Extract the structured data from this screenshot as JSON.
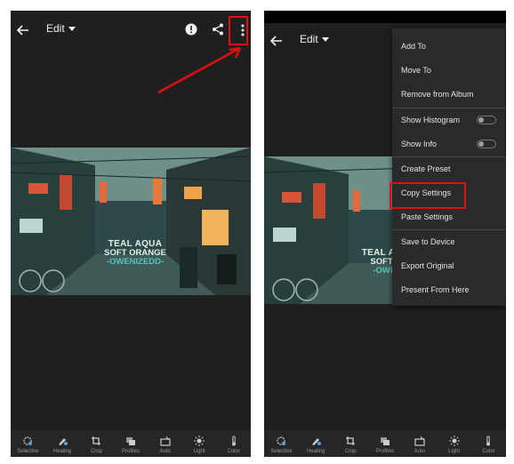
{
  "colors": {
    "highlight": "#e01010",
    "accent_teal": "#54c7bd",
    "panel": "#1f1f1f"
  },
  "left_screen": {
    "header": {
      "back_icon": "arrow-left-icon",
      "mode_label": "Edit",
      "icons": [
        "alert-info-icon",
        "share-icon",
        "more-vertical-icon"
      ]
    },
    "photo_overlay": {
      "line1": "TEAL AQUA",
      "line2": "SOFT ORANGE",
      "line3": "-OWENIZEDD-"
    },
    "annotation": "red arrow pointing to more options"
  },
  "right_screen": {
    "header": {
      "back_icon": "arrow-left-icon",
      "mode_label": "Edit"
    },
    "photo_overlay": {
      "line1": "TEAL AQUA",
      "line2": "SOFT OF",
      "line3": "-OWENI"
    },
    "menu": {
      "items": [
        {
          "label": "Add To"
        },
        {
          "label": "Move To"
        },
        {
          "label": "Remove from Album"
        },
        {
          "label": "Show Histogram",
          "toggle": false
        },
        {
          "label": "Show Info",
          "toggle": false
        },
        {
          "label": "Create Preset"
        },
        {
          "label": "Copy Settings",
          "highlighted": true
        },
        {
          "label": "Paste Settings"
        },
        {
          "label": "Save to Device"
        },
        {
          "label": "Export Original"
        },
        {
          "label": "Present From Here"
        }
      ]
    }
  },
  "toolbar": {
    "tools": [
      {
        "label": "Selective",
        "icon": "selective-icon"
      },
      {
        "label": "Healing",
        "icon": "healing-brush-icon"
      },
      {
        "label": "Crop",
        "icon": "crop-icon"
      },
      {
        "label": "Profiles",
        "icon": "profiles-icon"
      },
      {
        "label": "Auto",
        "icon": "auto-icon"
      },
      {
        "label": "Light",
        "icon": "sun-icon"
      },
      {
        "label": "Color",
        "icon": "thermometer-icon"
      }
    ]
  }
}
